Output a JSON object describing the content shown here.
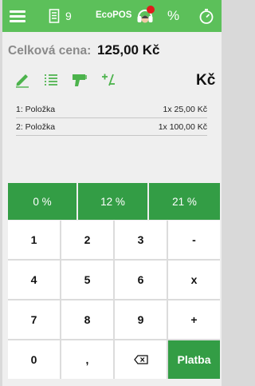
{
  "topbar": {
    "receipt_count": "9",
    "brand": "EcoPOS",
    "percent": "%"
  },
  "total": {
    "label": "Celková cena:",
    "value": "125,00 Kč"
  },
  "toolbar": {
    "currency": "Kč",
    "icons": [
      "pencil-icon",
      "list-icon",
      "barcode-scanner-icon",
      "plus-minus-icon"
    ]
  },
  "items": [
    {
      "name": "1: Položka",
      "qty_price": "1x 25,00 Kč"
    },
    {
      "name": "2: Položka",
      "qty_price": "1x 100,00 Kč"
    }
  ],
  "vat_buttons": [
    "0 %",
    "12 %",
    "21 %"
  ],
  "keypad": {
    "k1": "1",
    "k2": "2",
    "k3": "3",
    "minus": "-",
    "k4": "4",
    "k5": "5",
    "k6": "6",
    "times": "x",
    "k7": "7",
    "k8": "8",
    "k9": "9",
    "plus": "+",
    "k0": "0",
    "comma": ",",
    "pay": "Platba"
  },
  "colors": {
    "topbar": "#5cc05a",
    "accent": "#339d45",
    "badge": "#e01b1b"
  }
}
